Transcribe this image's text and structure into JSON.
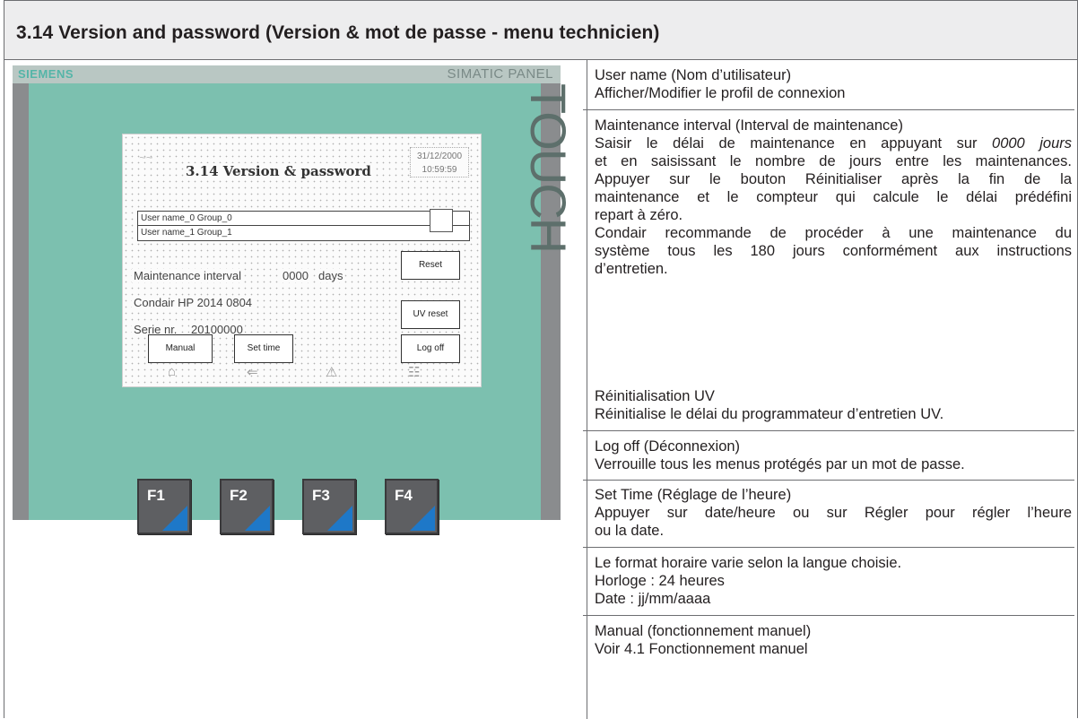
{
  "title": "3.14 Version and password (Version & mot de passe - menu technicien)",
  "panel": {
    "brand_left": "SIEMENS",
    "brand_right": "SIMATIC PANEL",
    "touch": "TOUCH",
    "screen_title": "3.14 Version & password",
    "date": "31/12/2000",
    "time": "10:59:59",
    "user_rows": [
      "User name_0  Group_0",
      "User name_1  Group_1"
    ],
    "maintenance_label": "Maintenance interval",
    "maintenance_value": "0000",
    "maintenance_unit": "days",
    "model": "Condair HP 2014 0804",
    "serial_label": "Serie nr.",
    "serial_value": "20100000",
    "buttons": {
      "reset": "Reset",
      "uv_reset": "UV reset",
      "manual": "Manual",
      "set_time": "Set time",
      "log_off": "Log off"
    },
    "fkeys": [
      "F1",
      "F2",
      "F3",
      "F4"
    ]
  },
  "sections": {
    "user_name": {
      "heading": "User name (Nom d’utilisateur)",
      "text": "Afficher/Modifier le profil de connexion"
    },
    "maintenance": {
      "heading": "Maintenance interval (Interval de maintenance)",
      "lines": [
        "Saisir le délai de maintenance en appuyant sur ",
        "0000 jours",
        "et en saisissant le nombre de jours entre les maintenances.",
        "Appuyer sur le bouton Réinitialiser après la fin de la",
        "maintenance et le compteur qui calcule le délai prédéfini",
        "repart à zéro.",
        "Condair recommande de procéder à une maintenance du",
        "système tous les 180 jours conformément aux instructions",
        "d’entretien."
      ]
    },
    "uv_reset": {
      "heading": "Réinitialisation UV",
      "text": "Réinitialise le délai du programmateur d’entretien UV."
    },
    "log_off": {
      "heading": "Log off (Déconnexion)",
      "text": "Verrouille tous les menus protégés par un mot de passe."
    },
    "set_time": {
      "heading": "Set Time (Réglage de l’heure)",
      "line1": "Appuyer sur date/heure ou sur Régler pour régler l’heure",
      "line2": "ou la date."
    },
    "format": {
      "line1": "Le format horaire varie selon la langue choisie.",
      "line2": "Horloge : 24 heures",
      "line3": "Date : jj/mm/aaaa"
    },
    "manual": {
      "heading": "Manual (fonctionnement manuel)",
      "text": "Voir 4.1 Fonctionnement manuel"
    }
  }
}
